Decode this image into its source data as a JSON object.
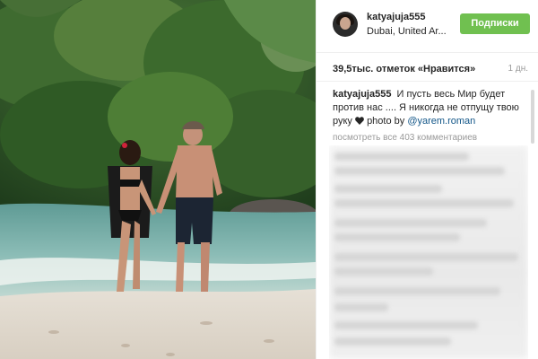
{
  "post": {
    "username": "katyajuja555",
    "location": "Dubai, United Ar...",
    "follow_label": "Подписки",
    "likes": "39,5тыс. отметок «Нравится»",
    "time_ago": "1 дн.",
    "caption": {
      "user": "katyajuja555",
      "text": "И пусть весь Мир будет против нас .... Я никогда не отпущу твою руку",
      "photo_by": "photo by",
      "mention": "@yarem.roman"
    },
    "view_comments": "посмотреть все 403 комментариев"
  },
  "colors": {
    "follow_button": "#70c050",
    "mention": "#125688",
    "muted_text": "#999999"
  },
  "icons": {
    "heart": "heart-icon"
  }
}
